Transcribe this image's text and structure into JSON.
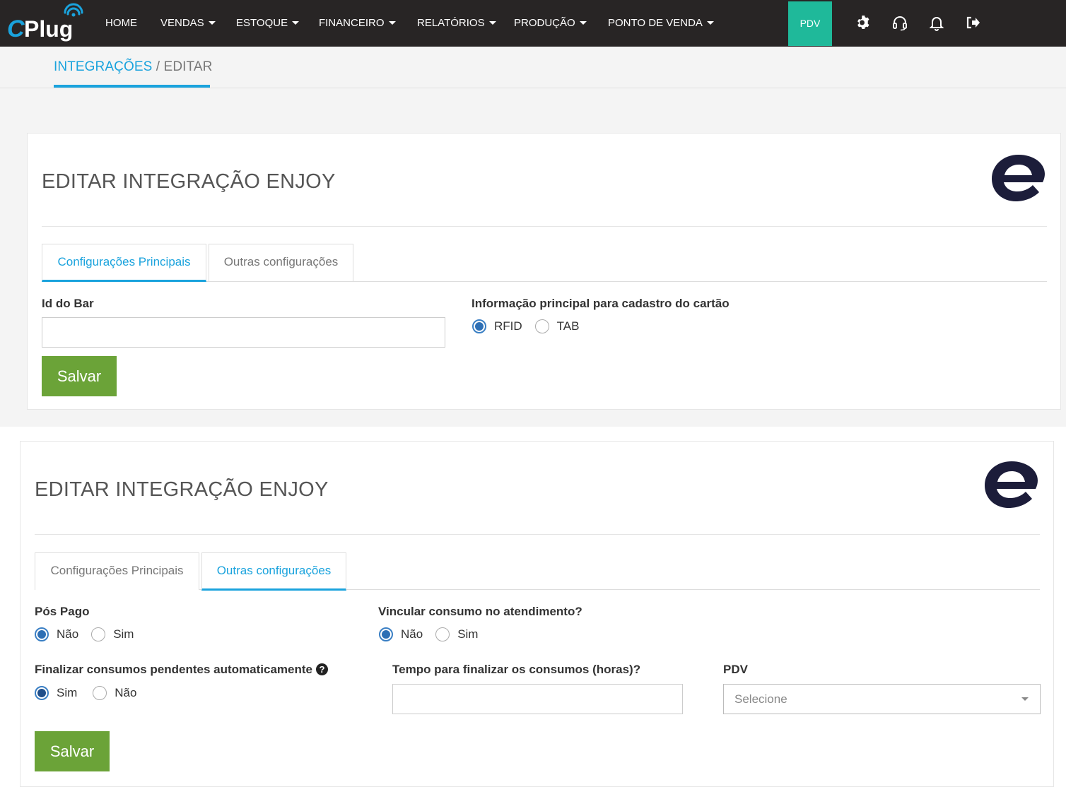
{
  "brand": {
    "logo_text": "CPlug"
  },
  "nav": {
    "items": [
      {
        "label": "HOME",
        "caret": false
      },
      {
        "label": "VENDAS",
        "caret": true
      },
      {
        "label": "ESTOQUE",
        "caret": true
      },
      {
        "label": "FINANCEIRO",
        "caret": true
      },
      {
        "label": "RELATÓRIOS",
        "caret": true
      },
      {
        "label": "PRODUÇÃO",
        "caret": true
      },
      {
        "label": "PONTO DE VENDA",
        "caret": true
      }
    ],
    "pdv_label": "PDV",
    "icons": [
      "gear-icon",
      "headset-icon",
      "bell-icon",
      "logout-icon"
    ],
    "colors": {
      "bar": "#282525",
      "pdv": "#1fb99a"
    }
  },
  "breadcrumb": {
    "link": "INTEGRAÇÕES",
    "separator": " / ",
    "current": "EDITAR"
  },
  "panel1": {
    "title": "EDITAR INTEGRAÇÃO ENJOY",
    "tabs": [
      {
        "label": "Configurações Principais",
        "active": true
      },
      {
        "label": "Outras configurações",
        "active": false
      }
    ],
    "id_bar": {
      "label": "Id do Bar",
      "value": "",
      "placeholder": ""
    },
    "card_info": {
      "label": "Informação principal para cadastro do cartão",
      "options": [
        {
          "label": "RFID",
          "checked": true
        },
        {
          "label": "TAB",
          "checked": false
        }
      ]
    },
    "save_label": "Salvar"
  },
  "panel2": {
    "title": "EDITAR INTEGRAÇÃO ENJOY",
    "tabs": [
      {
        "label": "Configurações Principais",
        "active": false
      },
      {
        "label": "Outras configurações",
        "active": true
      }
    ],
    "pos_pago": {
      "label": "Pós Pago",
      "options": [
        {
          "label": "Não",
          "checked": true
        },
        {
          "label": "Sim",
          "checked": false
        }
      ]
    },
    "vincular": {
      "label": "Vincular consumo no atendimento?",
      "options": [
        {
          "label": "Não",
          "checked": true
        },
        {
          "label": "Sim",
          "checked": false
        }
      ]
    },
    "finalizar": {
      "label": "Finalizar consumos pendentes automaticamente",
      "help": "?",
      "options": [
        {
          "label": "Sim",
          "checked": true
        },
        {
          "label": "Não",
          "checked": false
        }
      ]
    },
    "tempo": {
      "label": "Tempo para finalizar os consumos (horas)?",
      "value": "",
      "placeholder": ""
    },
    "pdv": {
      "label": "PDV",
      "selected": "Selecione"
    },
    "save_label": "Salvar"
  },
  "colors": {
    "accent": "#1aa3dd",
    "save": "#6ba338",
    "enjoy_logo": "#1c1d3a"
  }
}
